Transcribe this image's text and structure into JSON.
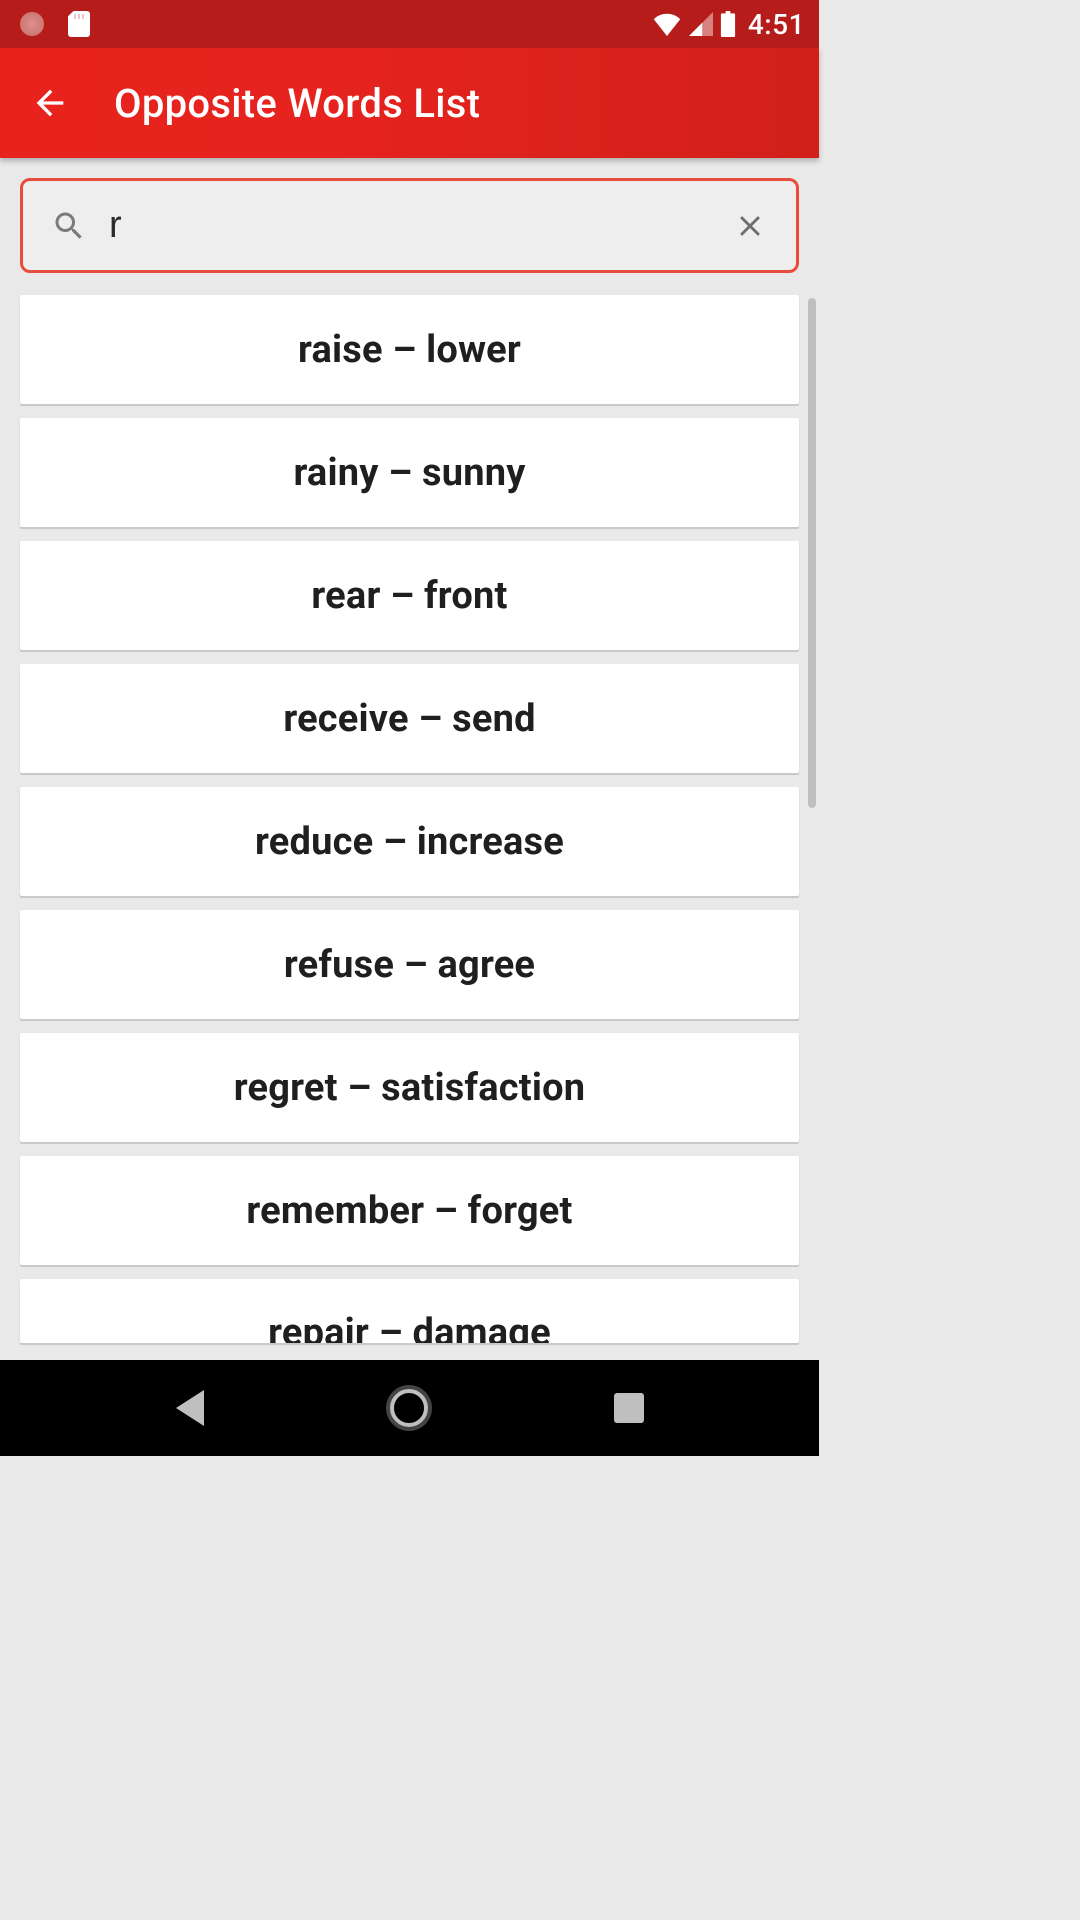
{
  "status": {
    "time": "4:51"
  },
  "appbar": {
    "title": "Opposite Words List"
  },
  "search": {
    "value": "r"
  },
  "items": [
    {
      "text": "raise – lower"
    },
    {
      "text": "rainy – sunny"
    },
    {
      "text": "rear – front"
    },
    {
      "text": "receive – send"
    },
    {
      "text": "reduce – increase"
    },
    {
      "text": "refuse – agree"
    },
    {
      "text": "regret – satisfaction"
    },
    {
      "text": "remember – forget"
    },
    {
      "text": "repair – damage"
    }
  ]
}
